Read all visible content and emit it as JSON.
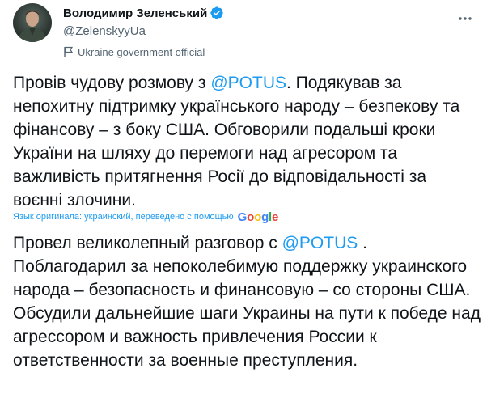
{
  "author": {
    "display_name": "Володимир Зеленський",
    "handle": "@ZelenskyyUa",
    "label": "Ukraine government official"
  },
  "icons": {
    "verified": "verified-badge-icon",
    "label_flag": "flag-icon",
    "more": "more-options-icon"
  },
  "colors": {
    "accent": "#1d9bf0",
    "secondary_text": "#536471",
    "primary_text": "#0f1419"
  },
  "tweet": {
    "original": {
      "before_mention": "Провів чудову розмову з ",
      "mention": "@POTUS",
      "after_mention": ". Подякував за непохитну підтримку українського народу – безпекову та фінансову – з боку США. Обговорили подальші кроки України на шляху до перемоги над агресором та важливість притягнення Росії до відповідальності за воєнні злочини."
    },
    "translation_note": "Язык оригинала: украинский, переведено с помощью",
    "translation_provider": [
      "G",
      "o",
      "o",
      "g",
      "l",
      "e"
    ],
    "translated": {
      "before_mention": "Провел великолепный разговор с ",
      "mention": "@POTUS",
      "after_mention": " . Поблагодарил за непоколебимую поддержку украинского народа – безопасность и финансовую – со стороны США. Обсудили дальнейшие шаги Украины на пути к победе над агрессором и важность привлечения России к ответственности за военные преступления."
    }
  }
}
